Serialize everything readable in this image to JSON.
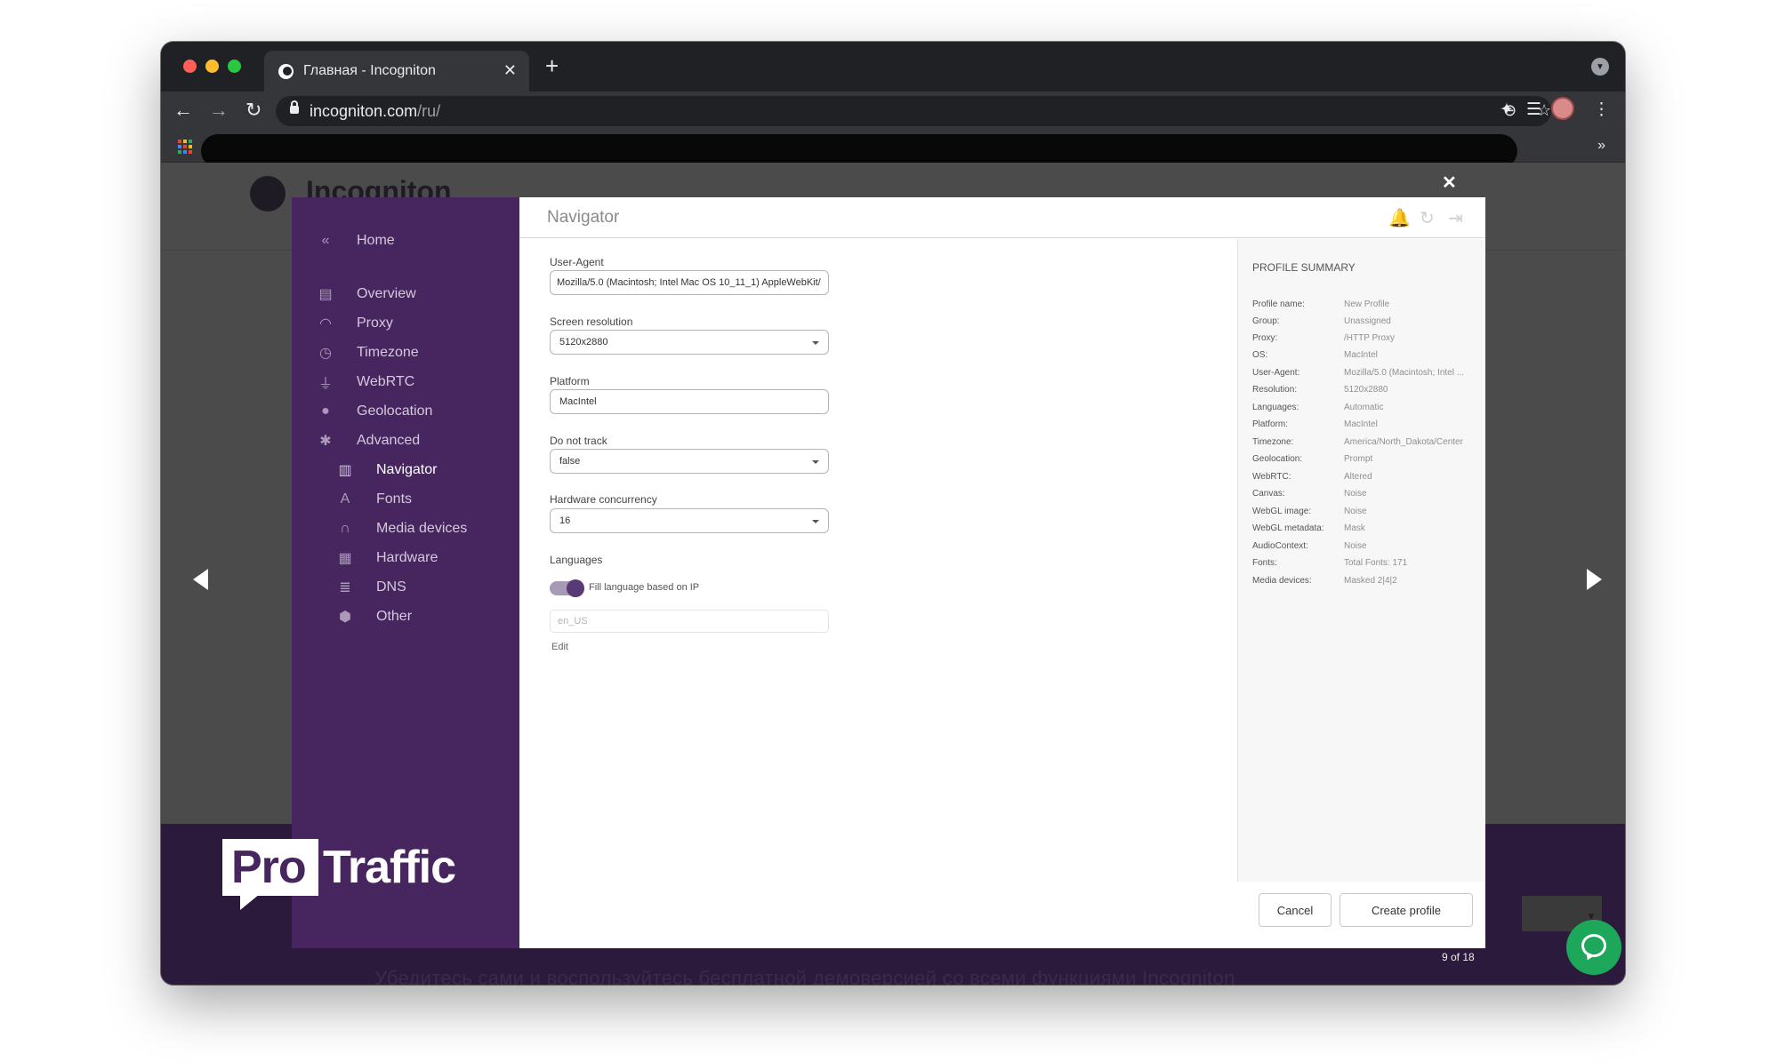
{
  "browser": {
    "tab_title": "Главная - Incogniton",
    "url_host": "incogniton.com",
    "url_path": "/ru/",
    "tab_close": "✕",
    "new_tab": "+",
    "more_bookmarks": "»"
  },
  "page": {
    "logo_text": "Incogniton",
    "bottom_text": "Убедитесь сами и воспользуйтесь бесплатной демоверсией со всеми функциями Incogniton",
    "counter": "9 of 18",
    "close": "✕"
  },
  "sidebar": {
    "home": "Home",
    "items": [
      {
        "label": "Overview",
        "icon": "id-card-icon"
      },
      {
        "label": "Proxy",
        "icon": "wifi-icon"
      },
      {
        "label": "Timezone",
        "icon": "clock-icon"
      },
      {
        "label": "WebRTC",
        "icon": "plug-icon"
      },
      {
        "label": "Geolocation",
        "icon": "map-pin-icon"
      },
      {
        "label": "Advanced",
        "icon": "asterisk-icon"
      }
    ],
    "sub_items": [
      {
        "label": "Navigator",
        "icon": "map-icon",
        "active": true
      },
      {
        "label": "Fonts",
        "icon": "font-icon"
      },
      {
        "label": "Media devices",
        "icon": "headphones-icon"
      },
      {
        "label": "Hardware",
        "icon": "chip-icon"
      },
      {
        "label": "DNS",
        "icon": "server-icon"
      },
      {
        "label": "Other",
        "icon": "cube-icon"
      }
    ],
    "watermark_pro": "Pro",
    "watermark_traffic": "Traffic"
  },
  "main": {
    "title": "Navigator",
    "fields": {
      "user_agent_label": "User-Agent",
      "user_agent_value": "Mozilla/5.0 (Macintosh; Intel Mac OS 10_11_1) AppleWebKit/",
      "resolution_label": "Screen resolution",
      "resolution_value": "5120x2880",
      "platform_label": "Platform",
      "platform_value": "MacIntel",
      "dnt_label": "Do not track",
      "dnt_value": "false",
      "hw_label": "Hardware concurrency",
      "hw_value": "16",
      "languages_label": "Languages",
      "fill_language_label": "Fill language based on IP",
      "fill_language_on": true,
      "language_placeholder": "en_US",
      "edit_link": "Edit"
    }
  },
  "summary": {
    "title": "PROFILE SUMMARY",
    "rows": [
      {
        "key": "Profile name:",
        "value": "New Profile"
      },
      {
        "key": "Group:",
        "value": "Unassigned"
      },
      {
        "key": "Proxy:",
        "value": "/HTTP Proxy"
      },
      {
        "key": "OS:",
        "value": "MacIntel"
      },
      {
        "key": "User-Agent:",
        "value": "Mozilla/5.0 (Macintosh; Intel ..."
      },
      {
        "key": "Resolution:",
        "value": "5120x2880"
      },
      {
        "key": "Languages:",
        "value": "Automatic"
      },
      {
        "key": "Platform:",
        "value": "MacIntel"
      },
      {
        "key": "Timezone:",
        "value": "America/North_Dakota/Center"
      },
      {
        "key": "Geolocation:",
        "value": "Prompt"
      },
      {
        "key": "WebRTC:",
        "value": "Altered"
      },
      {
        "key": "Canvas:",
        "value": "Noise"
      },
      {
        "key": "WebGL image:",
        "value": "Noise"
      },
      {
        "key": "WebGL metadata:",
        "value": "Mask"
      },
      {
        "key": "AudioContext:",
        "value": "Noise"
      },
      {
        "key": "Fonts:",
        "value": "Total Fonts: 171"
      },
      {
        "key": "Media devices:",
        "value": "Masked 2|4|2"
      }
    ],
    "cancel": "Cancel",
    "create": "Create profile"
  },
  "colors": {
    "sidebar": "#47265f",
    "chat": "#1da75b",
    "accent": "#5a3a76"
  }
}
